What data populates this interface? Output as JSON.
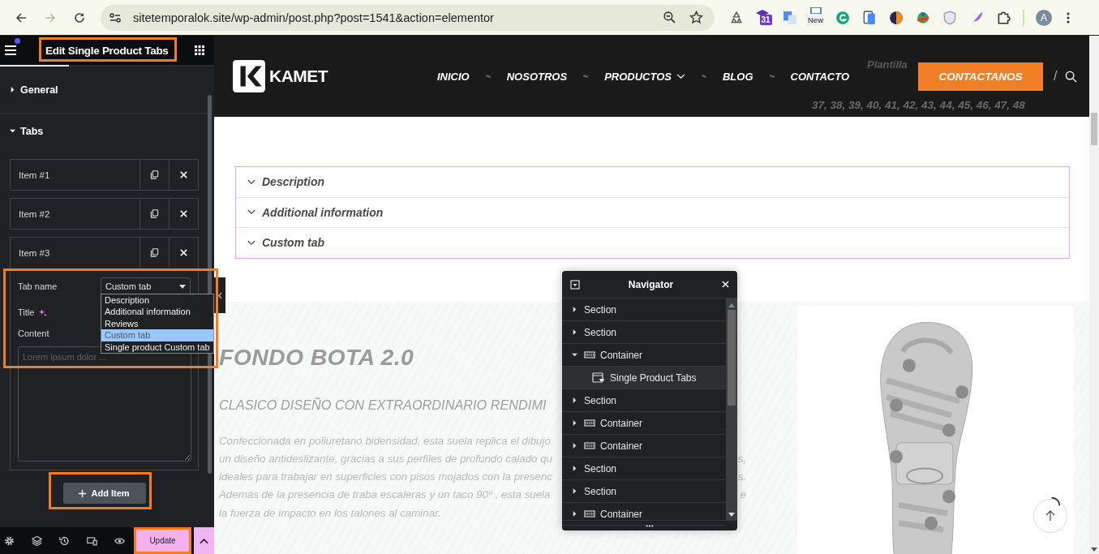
{
  "browser": {
    "url": "sitetemporalok.site/wp-admin/post.php?post=1541&action=elementor",
    "forward_disabled": true,
    "calendar_badge": "31",
    "new_badge": "New",
    "profile_initial": "A"
  },
  "editor": {
    "title": "Edit Single Product Tabs",
    "notification": true,
    "sections": [
      {
        "label": "General",
        "expanded": false
      },
      {
        "label": "Tabs",
        "expanded": true,
        "items": [
          {
            "label": "Item #1",
            "expanded": false
          },
          {
            "label": "Item #2",
            "expanded": false
          },
          {
            "label": "Item #3",
            "expanded": true,
            "fields": {
              "tab_name": {
                "label": "Tab name",
                "value": "Custom tab",
                "open": true,
                "options": [
                  {
                    "label": "Description",
                    "selected": false
                  },
                  {
                    "label": "Additional information",
                    "selected": false
                  },
                  {
                    "label": "Reviews",
                    "selected": false
                  },
                  {
                    "label": "Custom tab",
                    "selected": true
                  },
                  {
                    "label": "Single product Custom tab",
                    "selected": false
                  }
                ]
              },
              "title_label": "Title",
              "content_label": "Content",
              "content_placeholder": "Lorem ipsum dolor ..."
            }
          }
        ]
      }
    ],
    "add_button": "Add Item",
    "update_button": "Update"
  },
  "preview": {
    "logo": "KAMET",
    "nav": [
      {
        "label": "INICIO",
        "dropdown": false
      },
      {
        "label": "NOSOTROS",
        "dropdown": false
      },
      {
        "label": "PRODUCTOS",
        "dropdown": true
      },
      {
        "label": "BLOG",
        "dropdown": false
      },
      {
        "label": "CONTACTO",
        "dropdown": false
      }
    ],
    "cta": "CONTACTANOS",
    "slash": "/",
    "behind_header": {
      "heading": "Plantilla",
      "sizes": "37, 38, 39, 40, 41, 42, 43, 44, 45, 46, 47, 48"
    },
    "tabs": [
      {
        "label": "Description"
      },
      {
        "label": "Additional information"
      },
      {
        "label": "Custom tab"
      }
    ],
    "product": {
      "title": "FONDO BOTA 2.0",
      "subtitle": "CLASICO DISEÑO CON EXTRAORDINARIO RENDIMI",
      "lines": [
        {
          "left": "Confeccionada en poliuretano bidensidad, esta suela replica el dibujo"
        },
        {
          "left": "un diseño antideslizante, gracias a sus perfiles de profundo calado qu",
          "right": "s,"
        },
        {
          "left": "ideales para trabajar en superficies con pisos mojados con la presenc",
          "right": "s."
        },
        {
          "left": "Además de la presencia de traba escaleras y un taco 90º , esta suela",
          "right": "e"
        },
        {
          "left": "la fuerza de impacto en los talones al caminar."
        }
      ]
    }
  },
  "navigator": {
    "title": "Navigator",
    "items": [
      {
        "label": "Section",
        "kind": "section",
        "expanded": false,
        "selected": false
      },
      {
        "label": "Section",
        "kind": "section",
        "expanded": false,
        "selected": false
      },
      {
        "label": "Container",
        "kind": "container",
        "expanded": true,
        "selected": false,
        "children": [
          {
            "label": "Single Product Tabs",
            "kind": "widget",
            "selected": true
          }
        ]
      },
      {
        "label": "Section",
        "kind": "section",
        "expanded": false,
        "selected": false
      },
      {
        "label": "Container",
        "kind": "container",
        "expanded": false,
        "selected": false
      },
      {
        "label": "Container",
        "kind": "container",
        "expanded": false,
        "selected": false
      },
      {
        "label": "Section",
        "kind": "section",
        "expanded": false,
        "selected": false
      },
      {
        "label": "Section",
        "kind": "section",
        "expanded": false,
        "selected": false
      },
      {
        "label": "Container",
        "kind": "container",
        "expanded": false,
        "selected": false
      }
    ]
  }
}
